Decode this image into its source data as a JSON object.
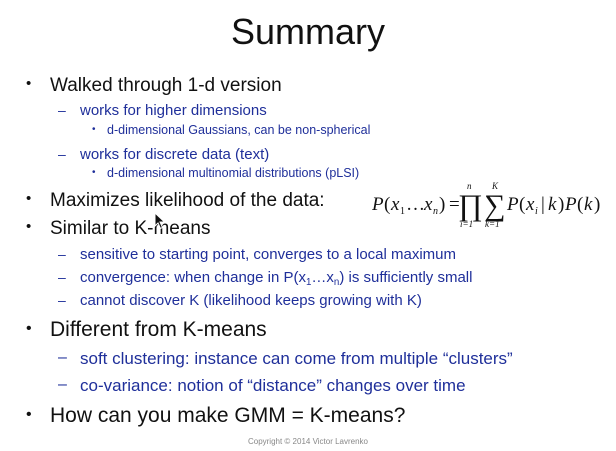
{
  "title": "Summary",
  "bullets": {
    "b1": "Walked through 1-d version",
    "b1_1": "works for higher dimensions",
    "b1_1_1": "d-dimensional Gaussians, can be non-spherical",
    "b1_2": "works for discrete data (text)",
    "b1_2_1": "d-dimensional multinomial distributions (pLSI)",
    "b2": "Maximizes likelihood of the data:",
    "b3": "Similar to K-means",
    "b3_1": "sensitive to starting point, converges to a local maximum",
    "b3_2_pre": "convergence: when change in P(x",
    "b3_2_sub1": "1",
    "b3_2_mid": "…x",
    "b3_2_sub2": "n",
    "b3_2_post": ") is sufficiently small",
    "b3_3": "cannot discover K (likelihood keeps growing with K)",
    "b4": "Different from K-means",
    "b4_1": "soft clustering: instance can come from multiple “clusters”",
    "b4_2": "co-variance: notion of “distance” changes over time",
    "b5": "How can you make GMM = K-means?"
  },
  "formula": {
    "lhs_p": "P",
    "lhs_open": "(",
    "lhs_x1": "x",
    "lhs_sub1": "1",
    "lhs_dots": "…",
    "lhs_xn": "x",
    "lhs_subn": "n",
    "lhs_close": ")",
    "equals": "=",
    "prod_top": "n",
    "prod_sym": "∏",
    "prod_bottom": "i=1",
    "sum_top": "K",
    "sum_sym": "∑",
    "sum_bottom": "k=1",
    "term1_p": "P",
    "term1_open": "(",
    "term1_x": "x",
    "term1_sub": "i",
    "term1_bar": "|",
    "term1_k": "k",
    "term1_close": ")",
    "term2_p": "P",
    "term2_open": "(",
    "term2_k": "k",
    "term2_close": ")"
  },
  "footer": "Copyright © 2014 Victor Lavrenko",
  "icons": {
    "pointer": "mouse-pointer-icon"
  }
}
